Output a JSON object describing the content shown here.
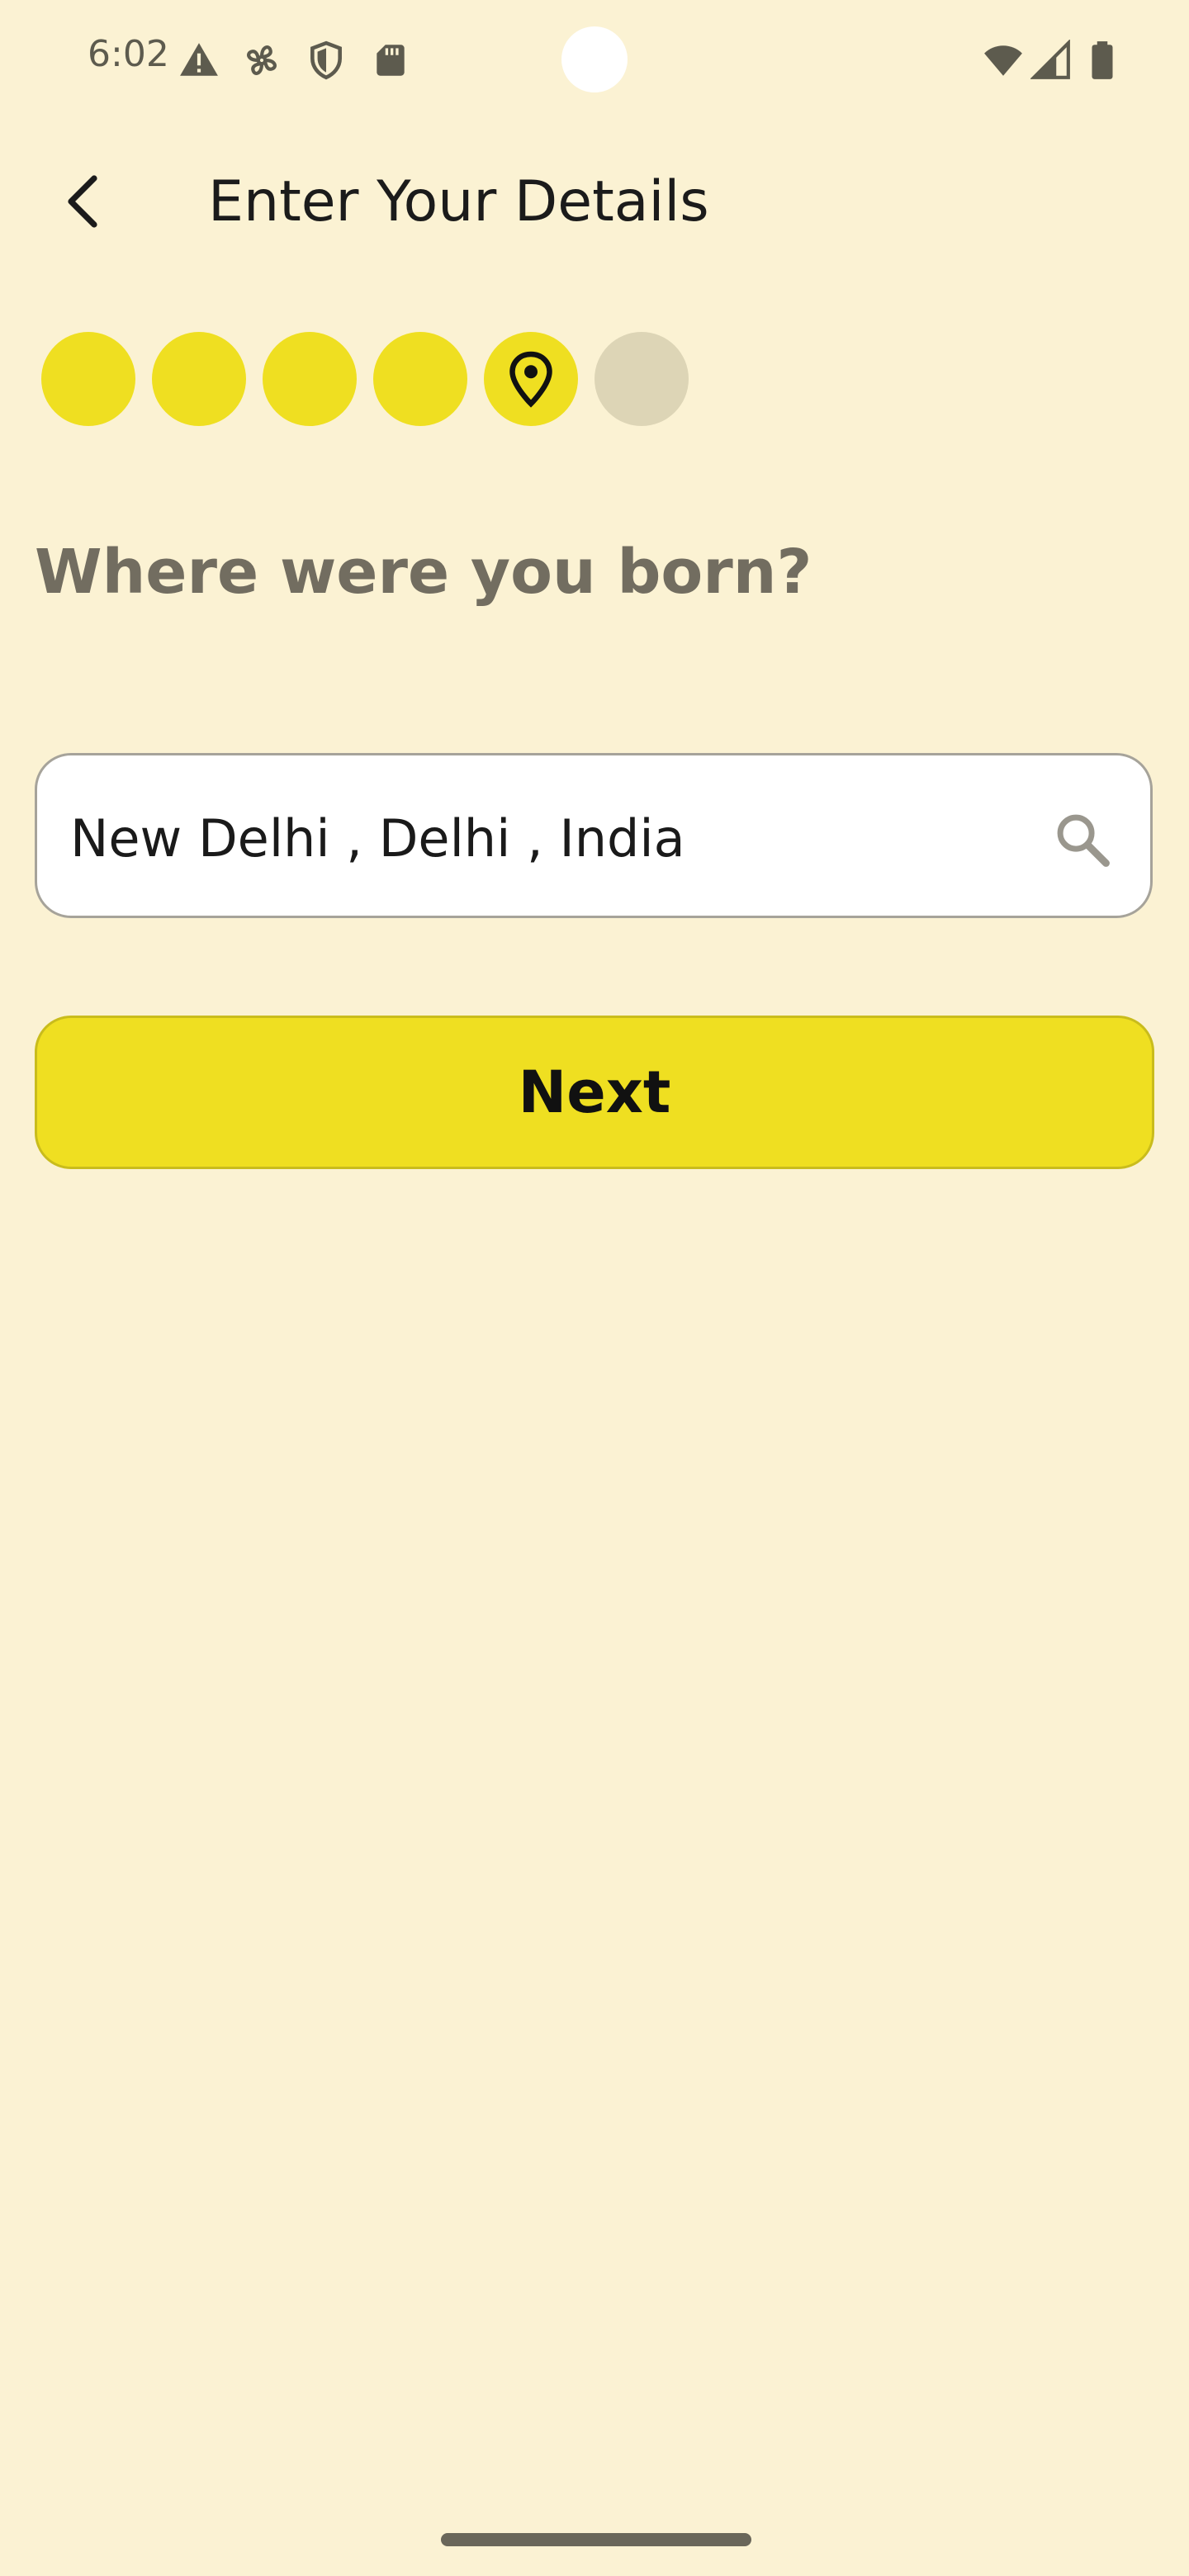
{
  "status_bar": {
    "time": "6:02",
    "icons": [
      "warning-icon",
      "fan-icon",
      "shield-icon",
      "sd-card-icon",
      "wifi-icon",
      "signal-icon",
      "battery-icon"
    ]
  },
  "app_bar": {
    "title": "Enter Your Details",
    "back_icon": "back-arrow-icon"
  },
  "progress": {
    "steps": [
      {
        "state": "done"
      },
      {
        "state": "done"
      },
      {
        "state": "done"
      },
      {
        "state": "done"
      },
      {
        "state": "current",
        "icon": "location-pin-icon"
      },
      {
        "state": "pending"
      }
    ],
    "current_step": 5,
    "total_steps": 6
  },
  "question": "Where were you born?",
  "birthplace_field": {
    "value": "New Delhi , Delhi , India",
    "icon": "search-icon"
  },
  "next_button": {
    "label": "Next"
  },
  "colors": {
    "background": "#FBF2D3",
    "accent": "#EFDF21",
    "pending_step": "#DDD5B6",
    "question_text": "#726D60"
  }
}
